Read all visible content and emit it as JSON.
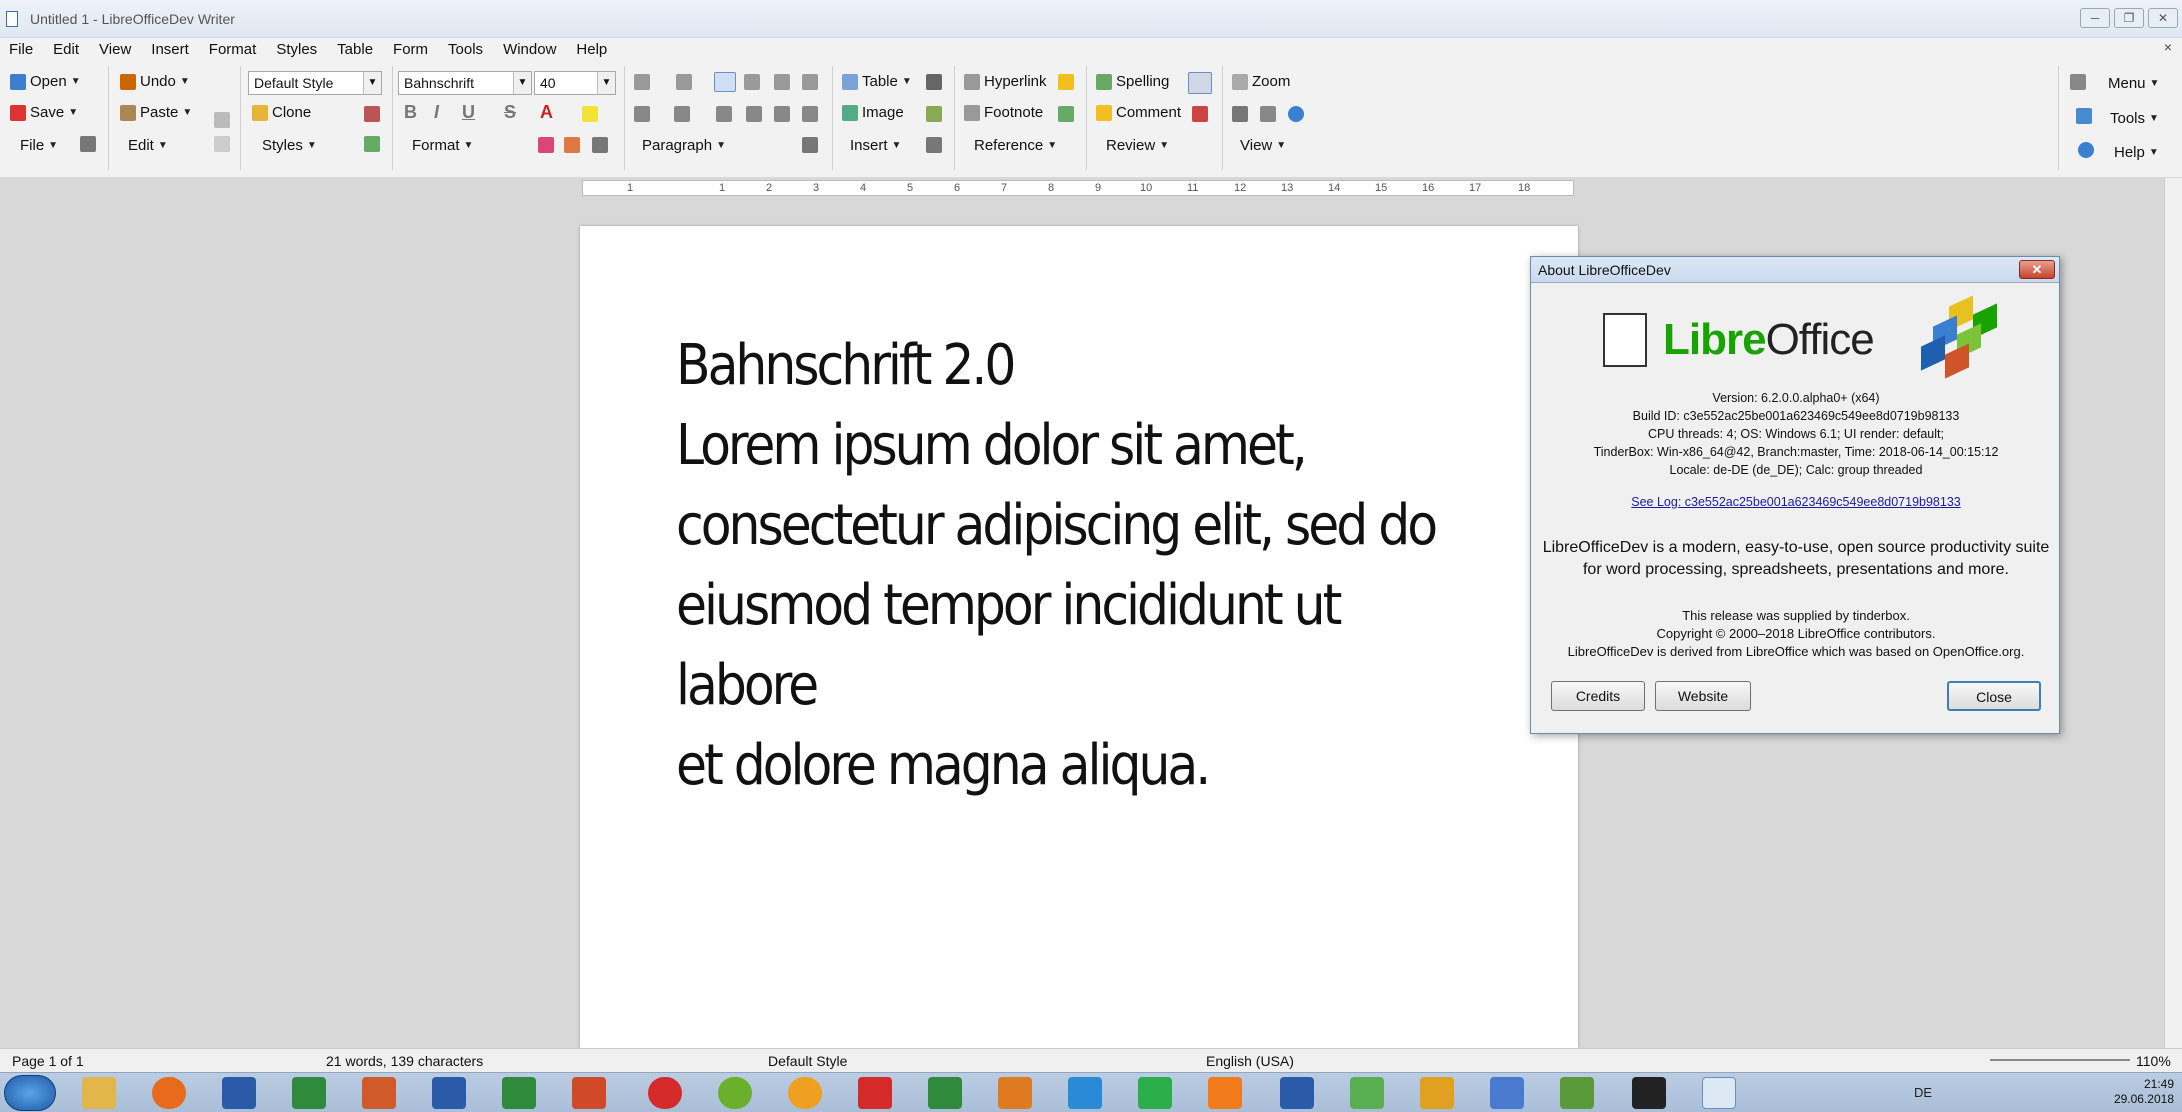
{
  "window": {
    "title": "Untitled 1 - LibreOfficeDev Writer",
    "controls": [
      "─",
      "❐",
      "✕"
    ]
  },
  "menubar": {
    "items": [
      "File",
      "Edit",
      "View",
      "Insert",
      "Format",
      "Styles",
      "Table",
      "Form",
      "Tools",
      "Window",
      "Help"
    ],
    "close": "×"
  },
  "toolbar": {
    "open": "Open",
    "save": "Save",
    "file": "File",
    "undo": "Undo",
    "paste": "Paste",
    "edit": "Edit",
    "para_style": "Default Style",
    "clone": "Clone",
    "styles": "Styles",
    "font_name": "Bahnschrift",
    "font_size": "40",
    "format": "Format",
    "paragraph": "Paragraph",
    "table": "Table",
    "image": "Image",
    "insert": "Insert",
    "hyperlink": "Hyperlink",
    "footnote": "Footnote",
    "reference": "Reference",
    "spelling": "Spelling",
    "comment": "Comment",
    "review": "Review",
    "zoom": "Zoom",
    "view": "View",
    "menu": "Menu",
    "tools": "Tools",
    "help": "Help",
    "bold": "B",
    "italic": "I",
    "underline": "U",
    "strike": "S",
    "fontcolor": "A"
  },
  "ruler": {
    "ticks": [
      "1",
      "1",
      "2",
      "3",
      "4",
      "5",
      "6",
      "7",
      "8",
      "9",
      "10",
      "11",
      "12",
      "13",
      "14",
      "15",
      "16",
      "17",
      "18"
    ]
  },
  "document": {
    "lines": [
      "Bahnschrift 2.0",
      "Lorem ipsum dolor sit amet,",
      "consectetur adipiscing elit, sed do",
      "eiusmod tempor incididunt ut labore",
      "et dolore magna aliqua."
    ]
  },
  "about": {
    "title": "About LibreOfficeDev",
    "logo_libre": "Libre",
    "logo_office": "Office",
    "version": "Version: 6.2.0.0.alpha0+ (x64)",
    "build": "Build ID: c3e552ac25be001a623469c549ee8d0719b98133",
    "cpu": "CPU threads: 4; OS: Windows 6.1; UI render: default;",
    "tinderbox": "TinderBox: Win-x86_64@42, Branch:master, Time: 2018-06-14_00:15:12",
    "locale": "Locale: de-DE (de_DE); Calc: group threaded",
    "log_link": "See Log: c3e552ac25be001a623469c549ee8d0719b98133",
    "description": "LibreOfficeDev is a modern, easy-to-use, open source productivity suite for word processing, spreadsheets, presentations and more.",
    "supplied": "This release was supplied by tinderbox.",
    "copyright": "Copyright © 2000–2018 LibreOffice contributors.",
    "derived": "LibreOfficeDev is derived from LibreOffice which was based on OpenOffice.org.",
    "credits": "Credits",
    "website": "Website",
    "close": "Close"
  },
  "statusbar": {
    "page": "Page 1 of 1",
    "words": "21 words, 139 characters",
    "style": "Default Style",
    "language": "English (USA)",
    "zoom": "110%"
  },
  "taskbar": {
    "lang": "DE",
    "time": "21:49",
    "date": "29.06.2018"
  }
}
